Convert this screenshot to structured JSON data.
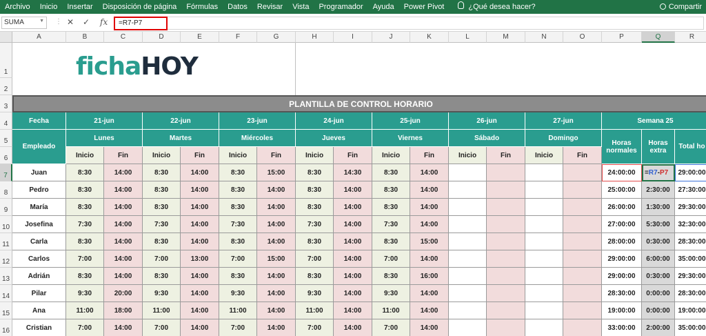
{
  "menu": [
    "Archivo",
    "Inicio",
    "Insertar",
    "Disposición de página",
    "Fórmulas",
    "Datos",
    "Revisar",
    "Vista",
    "Programador",
    "Ayuda",
    "Power Pivot"
  ],
  "tell_me": "¿Qué desea hacer?",
  "share_label": "Compartir",
  "name_box": "SUMA",
  "formula": "=R7-P7",
  "columns": [
    "A",
    "B",
    "C",
    "D",
    "E",
    "F",
    "G",
    "H",
    "I",
    "J",
    "K",
    "L",
    "M",
    "N",
    "O",
    "P",
    "Q",
    "R"
  ],
  "selected_column": "Q",
  "rows": [
    "1",
    "2",
    "3",
    "4",
    "5",
    "6",
    "7",
    "8",
    "9",
    "10",
    "11",
    "12",
    "13",
    "14",
    "15",
    "16"
  ],
  "selected_row": "7",
  "logo": {
    "part1": "ficha",
    "part2": "HOY"
  },
  "title": "PLANTILLA DE CONTROL HORARIO",
  "headers": {
    "fecha": "Fecha",
    "empleado": "Empleado",
    "dates": [
      "21-jun",
      "22-jun",
      "23-jun",
      "24-jun",
      "25-jun",
      "26-jun",
      "27-jun"
    ],
    "days": [
      "Lunes",
      "Martes",
      "Miércoles",
      "Jueves",
      "Viernes",
      "Sábado",
      "Domingo"
    ],
    "inicio": "Inicio",
    "fin": "Fin",
    "semana": "Semana 25",
    "horas_normales": "Horas normales",
    "horas_extra": "Horas extra",
    "total": "Total ho"
  },
  "employees": [
    {
      "name": "Juan",
      "times": [
        "8:30",
        "14:00",
        "8:30",
        "14:00",
        "8:30",
        "15:00",
        "8:30",
        "14:30",
        "8:30",
        "14:00"
      ],
      "normales": "24:00:00",
      "extra": "=R7-P7",
      "total": "29:00:00"
    },
    {
      "name": "Pedro",
      "times": [
        "8:30",
        "14:00",
        "8:30",
        "14:00",
        "8:30",
        "14:00",
        "8:30",
        "14:00",
        "8:30",
        "14:00"
      ],
      "normales": "25:00:00",
      "extra": "2:30:00",
      "total": "27:30:00"
    },
    {
      "name": "María",
      "times": [
        "8:30",
        "14:00",
        "8:30",
        "14:00",
        "8:30",
        "14:00",
        "8:30",
        "14:00",
        "8:30",
        "14:00"
      ],
      "normales": "26:00:00",
      "extra": "1:30:00",
      "total": "29:30:00"
    },
    {
      "name": "Josefina",
      "times": [
        "7:30",
        "14:00",
        "7:30",
        "14:00",
        "7:30",
        "14:00",
        "7:30",
        "14:00",
        "7:30",
        "14:00"
      ],
      "normales": "27:00:00",
      "extra": "5:30:00",
      "total": "32:30:00"
    },
    {
      "name": "Carla",
      "times": [
        "8:30",
        "14:00",
        "8:30",
        "14:00",
        "8:30",
        "14:00",
        "8:30",
        "14:00",
        "8:30",
        "15:00"
      ],
      "normales": "28:00:00",
      "extra": "0:30:00",
      "total": "28:30:00"
    },
    {
      "name": "Carlos",
      "times": [
        "7:00",
        "14:00",
        "7:00",
        "13:00",
        "7:00",
        "15:00",
        "7:00",
        "14:00",
        "7:00",
        "14:00"
      ],
      "normales": "29:00:00",
      "extra": "6:00:00",
      "total": "35:00:00"
    },
    {
      "name": "Adrián",
      "times": [
        "8:30",
        "14:00",
        "8:30",
        "14:00",
        "8:30",
        "14:00",
        "8:30",
        "14:00",
        "8:30",
        "16:00"
      ],
      "normales": "29:00:00",
      "extra": "0:30:00",
      "total": "29:30:00"
    },
    {
      "name": "Pilar",
      "times": [
        "9:30",
        "20:00",
        "9:30",
        "14:00",
        "9:30",
        "14:00",
        "9:30",
        "14:00",
        "9:30",
        "14:00"
      ],
      "normales": "28:30:00",
      "extra": "0:00:00",
      "total": "28:30:00"
    },
    {
      "name": "Ana",
      "times": [
        "11:00",
        "18:00",
        "11:00",
        "14:00",
        "11:00",
        "14:00",
        "11:00",
        "14:00",
        "11:00",
        "14:00"
      ],
      "normales": "19:00:00",
      "extra": "0:00:00",
      "total": "19:00:00"
    },
    {
      "name": "Cristian",
      "times": [
        "7:00",
        "14:00",
        "7:00",
        "14:00",
        "7:00",
        "14:00",
        "7:00",
        "14:00",
        "7:00",
        "14:00"
      ],
      "normales": "33:00:00",
      "extra": "2:00:00",
      "total": "35:00:00"
    }
  ]
}
